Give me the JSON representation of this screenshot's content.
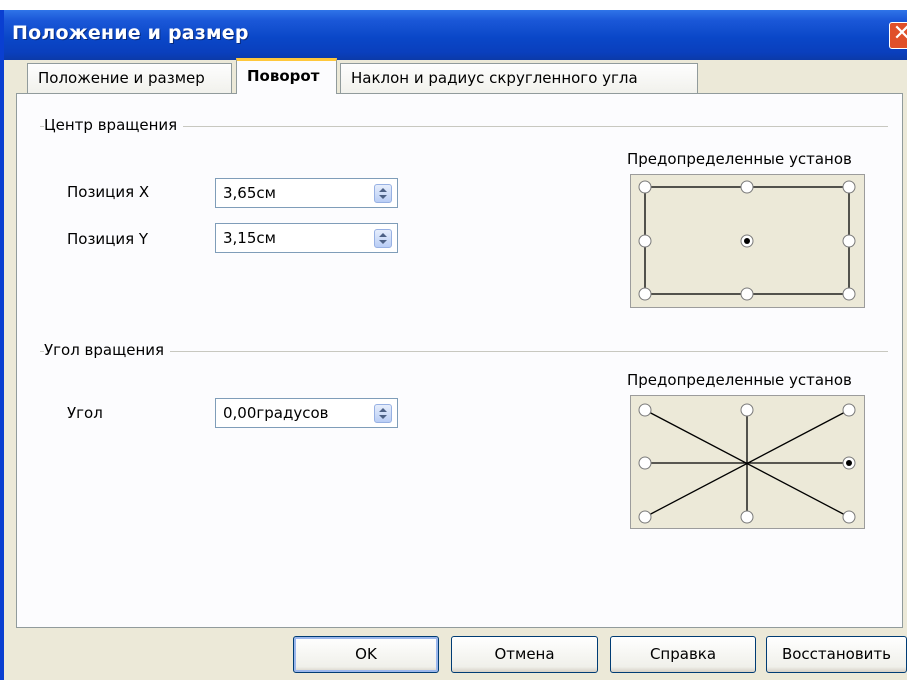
{
  "window": {
    "title": "Положение и размер",
    "close_glyph": "✕"
  },
  "tabs": [
    {
      "label": "Положение и размер"
    },
    {
      "label": "Поворот"
    },
    {
      "label": "Наклон и радиус скругленного угла"
    }
  ],
  "pivot": {
    "group_label": "Центр вращения",
    "x_label": "Позиция X",
    "x_value": "3,65см",
    "y_label": "Позиция Y",
    "y_value": "3,15см",
    "preset_label": "Предопределенные установ",
    "selected_point": "center"
  },
  "angle": {
    "group_label": "Угол вращения",
    "angle_label": "Угол",
    "angle_value": "0,00градусов",
    "preset_label": "Предопределенные установ",
    "selected_point": "middle-right"
  },
  "buttons": {
    "ok": "OK",
    "cancel": "Отмена",
    "help": "Справка",
    "reset": "Восстановить"
  },
  "colors": {
    "title_bar": "#0a47c8",
    "dialog_bg": "#ece9d8",
    "active_tab_accent": "#ffc83c"
  }
}
